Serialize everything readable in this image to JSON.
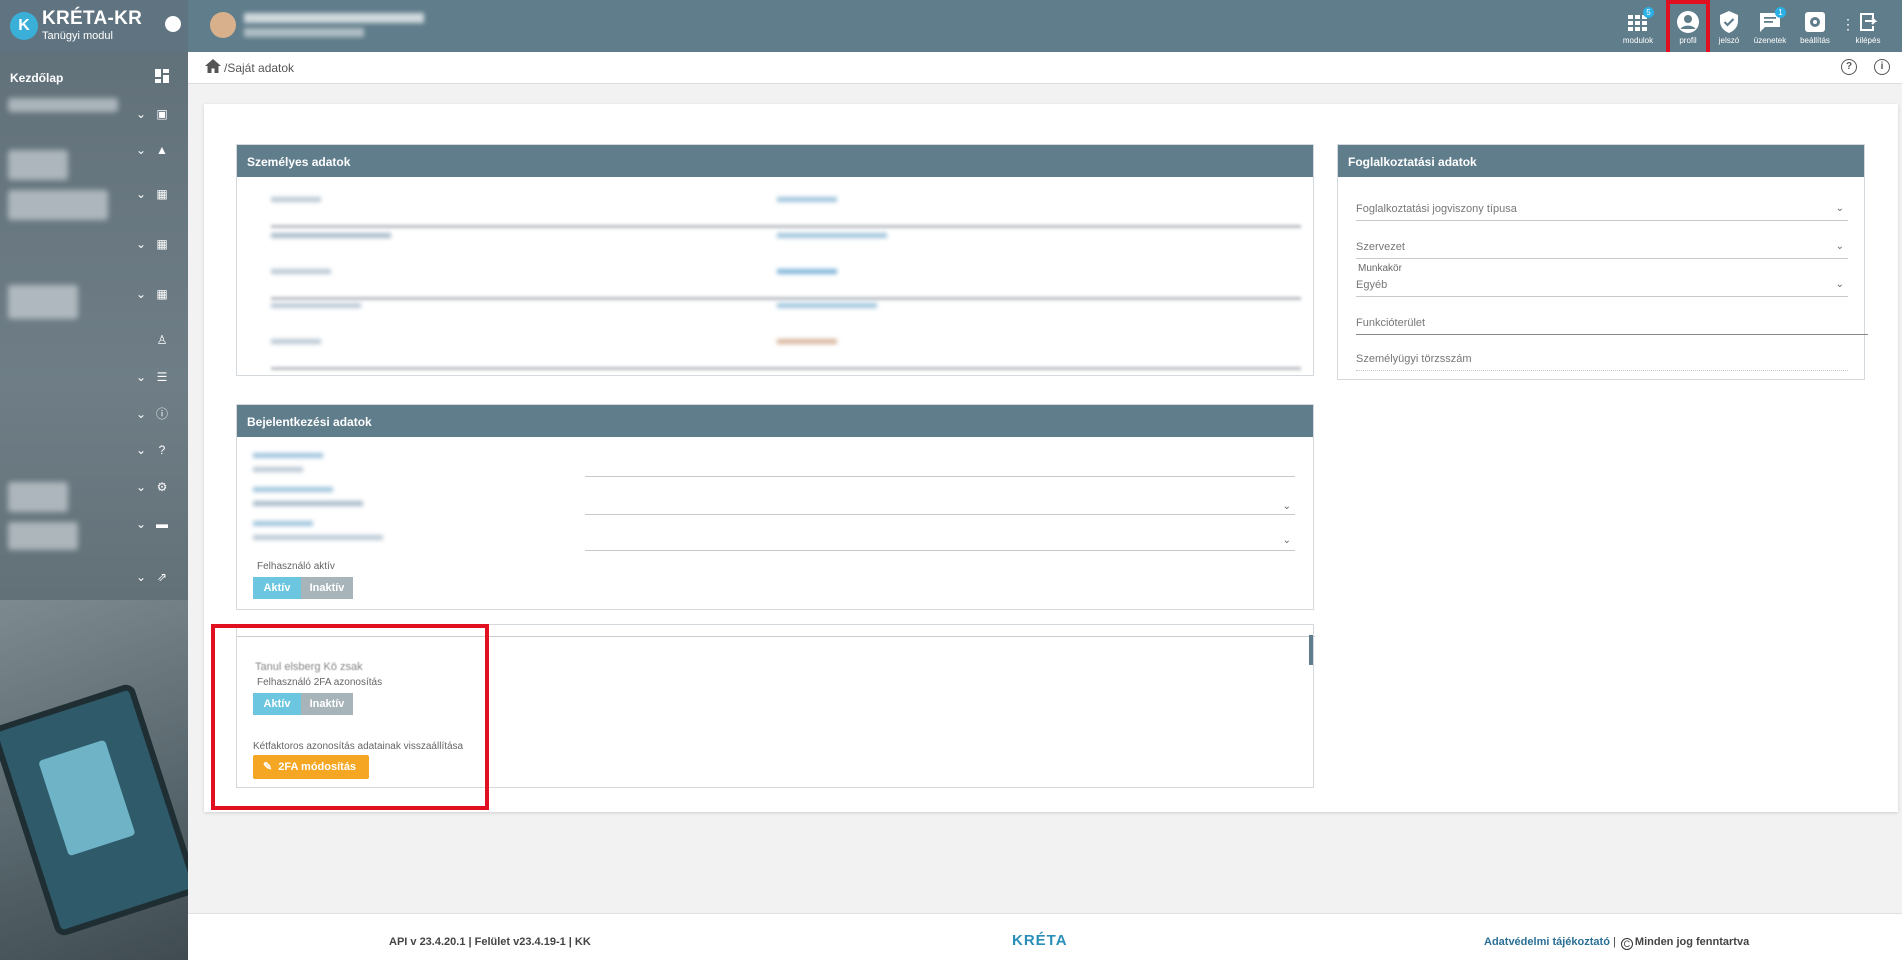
{
  "app": {
    "title": "KRÉTA-KR",
    "subtitle": "Tanügyi modul",
    "logo_letter": "K"
  },
  "sidebar": {
    "home_label": "Kezdőlap"
  },
  "topbar": {
    "buttons": [
      {
        "label": "modulok",
        "badge": "5",
        "icon": "grid-icon"
      },
      {
        "label": "profil",
        "badge": "",
        "icon": "profile-icon"
      },
      {
        "label": "jelszó",
        "badge": "",
        "icon": "shield-check-icon"
      },
      {
        "label": "üzenetek",
        "badge": "1",
        "icon": "chat-icon"
      },
      {
        "label": "beállítás",
        "badge": "",
        "icon": "gear-icon"
      },
      {
        "label": "kilépés",
        "badge": "",
        "icon": "logout-icon"
      }
    ]
  },
  "breadcrumb": {
    "text": "/Saját adatok"
  },
  "panels": {
    "personal": {
      "title": "Személyes adatok"
    },
    "employment": {
      "title": "Foglalkoztatási adatok",
      "fields": {
        "jogviszony": "Foglalkoztatási jogviszony típusa",
        "szervezet": "Szervezet",
        "munkakor_label": "Munkakör",
        "munkakor_value": "Egyéb",
        "funkcioterulet": "Funkcióterület",
        "torzsszam": "Személyügyi törzsszám"
      }
    },
    "login": {
      "title": "Bejelentkezési adatok",
      "active_label": "Felhasználó aktív",
      "toggle_on": "Aktív",
      "toggle_off": "Inaktív"
    },
    "twofa": {
      "partial_text": "Tanul elsberg Kö  zsak",
      "twofa_label": "Felhasználó 2FA azonosítás",
      "toggle_on": "Aktív",
      "toggle_off": "Inaktív",
      "reset_label": "Kétfaktoros azonosítás adatainak visszaállítása",
      "button_label": "2FA módosítás"
    }
  },
  "footer": {
    "version": "API v 23.4.20.1 | Felület v23.4.19-1 | KK",
    "logo": "KRÉTA",
    "privacy_link": "Adatvédelmi tájékoztató",
    "separator": " | ",
    "rights": "Minden jog fenntartva",
    "copyright_symbol": "C"
  },
  "colors": {
    "topbar": "#607d8b",
    "accent_blue": "#6cc6e0",
    "orange": "#f5a623",
    "highlight_red": "#e01020"
  }
}
